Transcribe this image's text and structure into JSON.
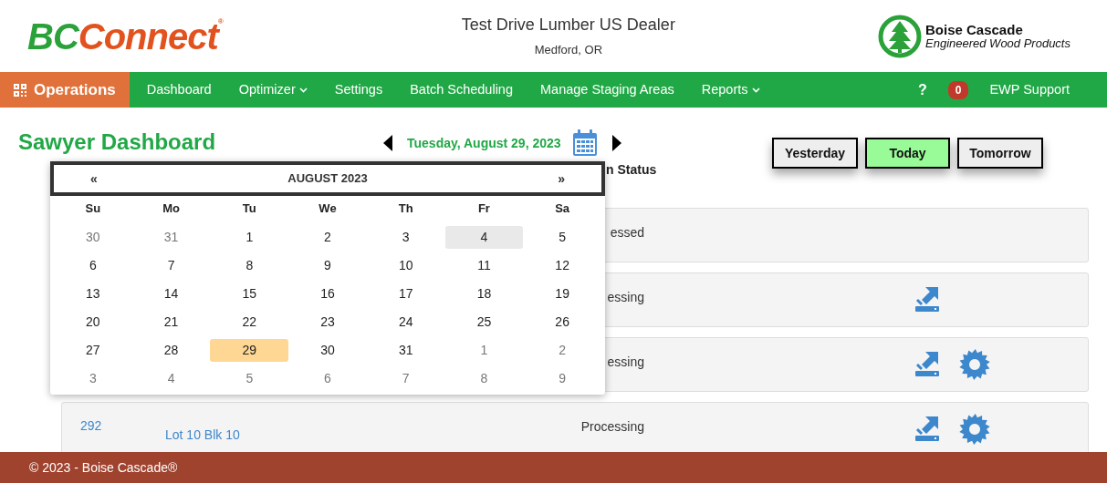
{
  "header": {
    "logo": {
      "part1": "BC",
      "part2": "Connect",
      "mark": "®"
    },
    "dealer": "Test Drive Lumber US Dealer",
    "location": "Medford, OR",
    "brand": {
      "line1": "Boise Cascade",
      "line2": "Engineered Wood Products"
    }
  },
  "nav": {
    "home": "Operations",
    "items": [
      {
        "label": "Dashboard",
        "dropdown": false
      },
      {
        "label": "Optimizer",
        "dropdown": true
      },
      {
        "label": "Settings",
        "dropdown": false
      },
      {
        "label": "Batch Scheduling",
        "dropdown": false
      },
      {
        "label": "Manage Staging Areas",
        "dropdown": false
      },
      {
        "label": "Reports",
        "dropdown": true
      }
    ],
    "help": "?",
    "count": "0",
    "support": "EWP Support"
  },
  "page": {
    "title": "Sawyer Dashboard",
    "date": "Tuesday, August 29, 2023",
    "quick": [
      {
        "label": "Yesterday",
        "selected": false
      },
      {
        "label": "Today",
        "selected": true
      },
      {
        "label": "Tomorrow",
        "selected": false
      }
    ]
  },
  "table": {
    "status_header": "n Status",
    "rows": [
      {
        "status": "essed",
        "transfer_icon": false,
        "saw_icon": false
      },
      {
        "status": "essing",
        "transfer_icon": true,
        "saw_icon": false
      },
      {
        "status": "essing",
        "transfer_icon": true,
        "saw_icon": true
      },
      {
        "column_1": "292",
        "column_2": "Lot 10 Blk 10",
        "status": "Processing",
        "transfer_icon": true,
        "saw_icon": true
      }
    ]
  },
  "datepicker": {
    "prev": "«",
    "month": "AUGUST 2023",
    "next": "»",
    "weekdays": [
      "Su",
      "Mo",
      "Tu",
      "We",
      "Th",
      "Fr",
      "Sa"
    ],
    "days": [
      {
        "label": "30",
        "other_month": true,
        "selected": false,
        "hovered": false
      },
      {
        "label": "31",
        "other_month": true,
        "selected": false,
        "hovered": false
      },
      {
        "label": "1",
        "other_month": false,
        "selected": false,
        "hovered": false
      },
      {
        "label": "2",
        "other_month": false,
        "selected": false,
        "hovered": false
      },
      {
        "label": "3",
        "other_month": false,
        "selected": false,
        "hovered": false
      },
      {
        "label": "4",
        "other_month": false,
        "selected": false,
        "hovered": true
      },
      {
        "label": "5",
        "other_month": false,
        "selected": false,
        "hovered": false
      },
      {
        "label": "6",
        "other_month": false,
        "selected": false,
        "hovered": false
      },
      {
        "label": "7",
        "other_month": false,
        "selected": false,
        "hovered": false
      },
      {
        "label": "8",
        "other_month": false,
        "selected": false,
        "hovered": false
      },
      {
        "label": "9",
        "other_month": false,
        "selected": false,
        "hovered": false
      },
      {
        "label": "10",
        "other_month": false,
        "selected": false,
        "hovered": false
      },
      {
        "label": "11",
        "other_month": false,
        "selected": false,
        "hovered": false
      },
      {
        "label": "12",
        "other_month": false,
        "selected": false,
        "hovered": false
      },
      {
        "label": "13",
        "other_month": false,
        "selected": false,
        "hovered": false
      },
      {
        "label": "14",
        "other_month": false,
        "selected": false,
        "hovered": false
      },
      {
        "label": "15",
        "other_month": false,
        "selected": false,
        "hovered": false
      },
      {
        "label": "16",
        "other_month": false,
        "selected": false,
        "hovered": false
      },
      {
        "label": "17",
        "other_month": false,
        "selected": false,
        "hovered": false
      },
      {
        "label": "18",
        "other_month": false,
        "selected": false,
        "hovered": false
      },
      {
        "label": "19",
        "other_month": false,
        "selected": false,
        "hovered": false
      },
      {
        "label": "20",
        "other_month": false,
        "selected": false,
        "hovered": false
      },
      {
        "label": "21",
        "other_month": false,
        "selected": false,
        "hovered": false
      },
      {
        "label": "22",
        "other_month": false,
        "selected": false,
        "hovered": false
      },
      {
        "label": "23",
        "other_month": false,
        "selected": false,
        "hovered": false
      },
      {
        "label": "24",
        "other_month": false,
        "selected": false,
        "hovered": false
      },
      {
        "label": "25",
        "other_month": false,
        "selected": false,
        "hovered": false
      },
      {
        "label": "26",
        "other_month": false,
        "selected": false,
        "hovered": false
      },
      {
        "label": "27",
        "other_month": false,
        "selected": false,
        "hovered": false
      },
      {
        "label": "28",
        "other_month": false,
        "selected": false,
        "hovered": false
      },
      {
        "label": "29",
        "other_month": false,
        "selected": true,
        "hovered": false
      },
      {
        "label": "30",
        "other_month": false,
        "selected": false,
        "hovered": false
      },
      {
        "label": "31",
        "other_month": false,
        "selected": false,
        "hovered": false
      },
      {
        "label": "1",
        "other_month": true,
        "selected": false,
        "hovered": false
      },
      {
        "label": "2",
        "other_month": true,
        "selected": false,
        "hovered": false
      },
      {
        "label": "3",
        "other_month": true,
        "selected": false,
        "hovered": false
      },
      {
        "label": "4",
        "other_month": true,
        "selected": false,
        "hovered": false
      },
      {
        "label": "5",
        "other_month": true,
        "selected": false,
        "hovered": false
      },
      {
        "label": "6",
        "other_month": true,
        "selected": false,
        "hovered": false
      },
      {
        "label": "7",
        "other_month": true,
        "selected": false,
        "hovered": false
      },
      {
        "label": "8",
        "other_month": true,
        "selected": false,
        "hovered": false
      },
      {
        "label": "9",
        "other_month": true,
        "selected": false,
        "hovered": false
      }
    ]
  },
  "footer": "© 2023 - Boise Cascade®"
}
